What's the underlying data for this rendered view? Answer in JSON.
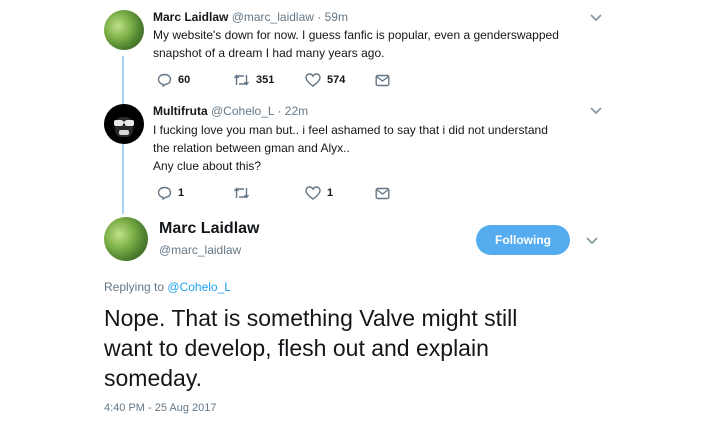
{
  "tweet1": {
    "name": "Marc Laidlaw",
    "handle": "@marc_laidlaw",
    "time": "· 59m",
    "text": "My website's down for now. I guess fanfic is popular, even a genderswapped snapshot of a dream I had many years ago.",
    "replies": "60",
    "retweets": "351",
    "likes": "574"
  },
  "tweet2": {
    "name": "Multifruta",
    "handle": "@Cohelo_L",
    "time": "· 22m",
    "text_lines": [
      "I fucking love you man but.. i feel ashamed to say that i did not understand",
      "the relation between gman and Alyx..",
      "Any clue about this?"
    ],
    "replies": "1",
    "retweets": "",
    "likes": "1"
  },
  "main_tweet": {
    "name": "Marc Laidlaw",
    "handle": "@marc_laidlaw",
    "follow_label": "Following",
    "replying_prefix": "Replying to",
    "replying_to": "@Cohelo_L",
    "text_lines": [
      "Nope. That is something Valve might still",
      "want to develop, flesh out and explain",
      "someday."
    ],
    "timestamp": "4:40 PM - 25 Aug 2017"
  },
  "colors": {
    "accent": "#55acee",
    "link": "#1da1f2",
    "thread_line": "#a9d3f7",
    "secondary_text": "#657786"
  },
  "icons": [
    "reply-icon",
    "retweet-icon",
    "like-icon",
    "message-icon",
    "chevron-down-icon"
  ]
}
